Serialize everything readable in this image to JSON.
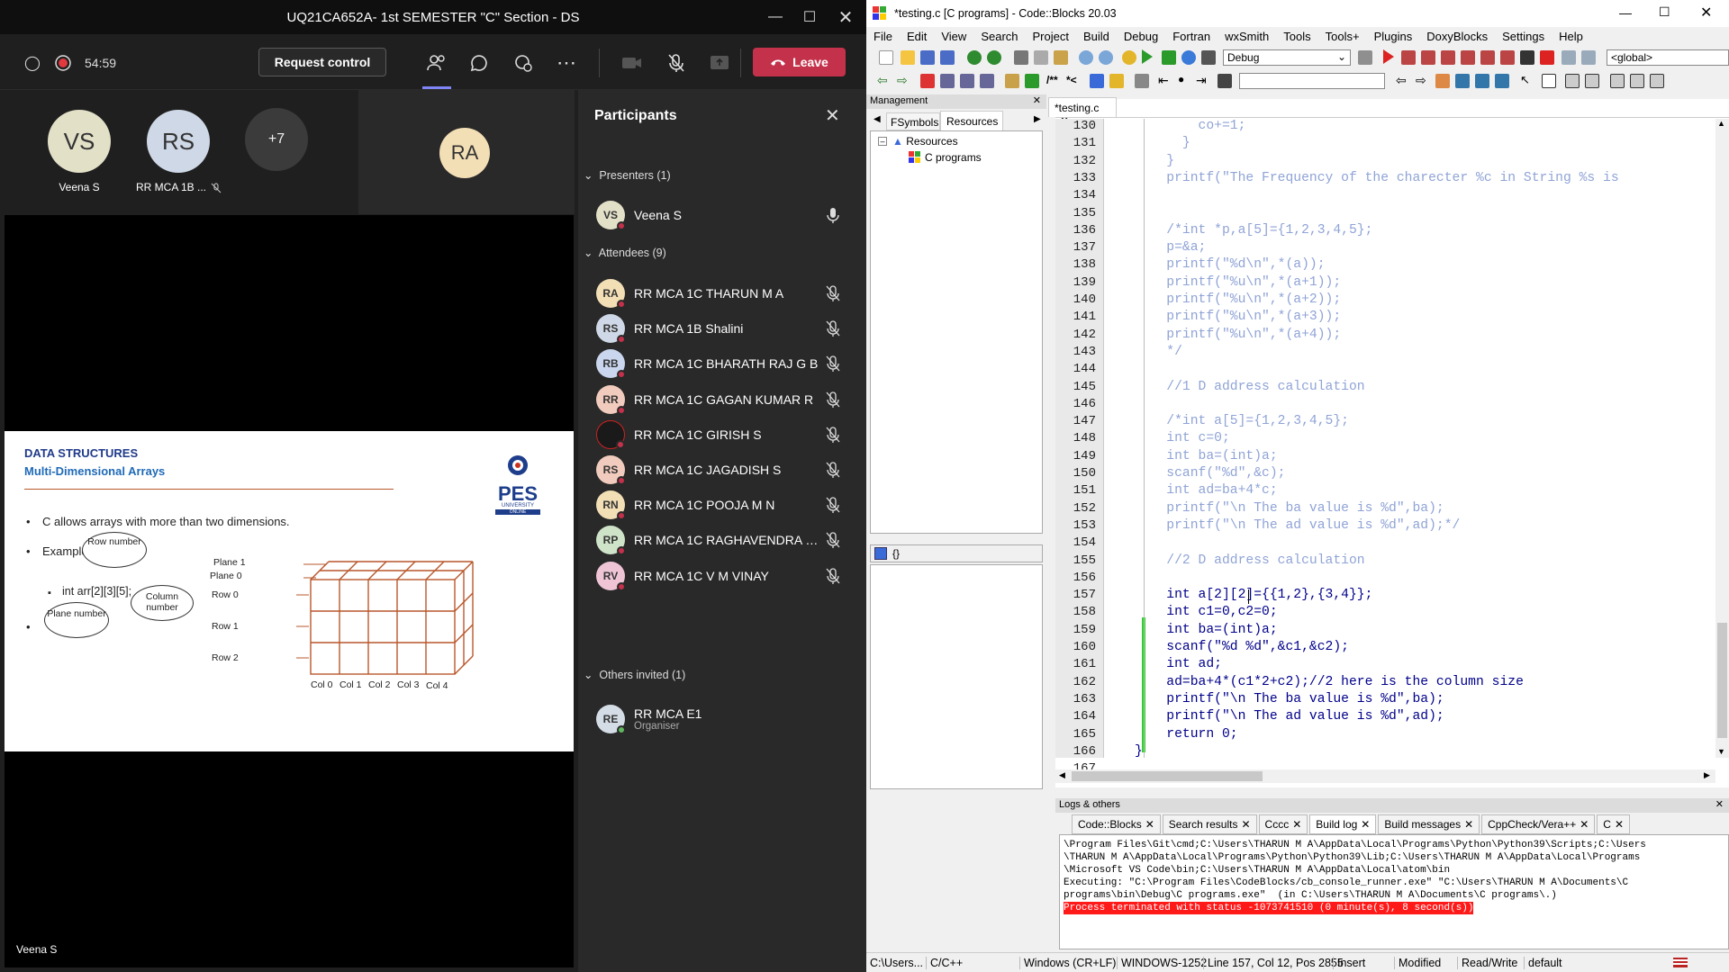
{
  "teams": {
    "title": "UQ21CA652A- 1st SEMESTER \"C\" Section - DS",
    "timer": "54:59",
    "request_control": "Request control",
    "leave": "Leave",
    "tiles": [
      {
        "initials": "VS",
        "name": "Veena S",
        "color": "#e3e0c8"
      },
      {
        "initials": "RS",
        "name": "RR MCA 1B ...",
        "color": "#cfd8e6"
      },
      {
        "initials": "+7",
        "name": "",
        "color": "#3b3b3b"
      },
      {
        "initials": "RA",
        "name": "",
        "color": "#f3dfb6"
      }
    ],
    "presenter_label": "Veena S",
    "panel": {
      "title": "Participants",
      "presenters_header": "Presenters (1)",
      "attendees_header": "Attendees (9)",
      "others_header": "Others invited (1)",
      "presenters": [
        {
          "initials": "VS",
          "name": "Veena S",
          "color": "#e3e0c8"
        }
      ],
      "attendees": [
        {
          "initials": "RA",
          "name": "RR MCA 1C THARUN M A",
          "color": "#f3dfb6"
        },
        {
          "initials": "RS",
          "name": "RR MCA 1B Shalini",
          "color": "#cfd8e6"
        },
        {
          "initials": "RB",
          "name": "RR MCA 1C BHARATH RAJ G B",
          "color": "#c9d6ee"
        },
        {
          "initials": "RR",
          "name": "RR MCA 1C GAGAN KUMAR R",
          "color": "#f1cbbd"
        },
        {
          "initials": "",
          "name": "RR MCA 1C GIRISH S",
          "color": "#1a1a1a"
        },
        {
          "initials": "RS",
          "name": "RR MCA 1C JAGADISH S",
          "color": "#f1cbbd"
        },
        {
          "initials": "RN",
          "name": "RR MCA 1C POOJA M N",
          "color": "#f3dfb6"
        },
        {
          "initials": "RP",
          "name": "RR MCA 1C RAGHAVENDRA N P...",
          "color": "#cfe3c8"
        },
        {
          "initials": "RV",
          "name": "RR MCA 1C V M VINAY",
          "color": "#efc5d6"
        }
      ],
      "others": [
        {
          "initials": "RE",
          "name": "RR MCA E1",
          "sub": "Organiser",
          "color": "#d4dde6"
        }
      ]
    },
    "slide": {
      "title1": "DATA STRUCTURES",
      "title2": "Multi-Dimensional Arrays",
      "bullet1": "C allows arrays with more than two dimensions.",
      "bullet2": "Example",
      "code": "int arr[2][3][5];",
      "bubble_row": "Row number",
      "bubble_col": "Column number",
      "bubble_plane": "Plane number",
      "plane1": "Plane 1",
      "plane0": "Plane 0",
      "rows": [
        "Row 0",
        "Row 1",
        "Row 2"
      ],
      "cols": [
        "Col 0",
        "Col 1",
        "Col 2",
        "Col 3",
        "Col 4"
      ],
      "logo": "PES",
      "logo_sub": "UNIVERSITY",
      "logo_sub2": "ONLINE"
    }
  },
  "codeblocks": {
    "title": "*testing.c [C programs] - Code::Blocks 20.03",
    "menu": [
      "File",
      "Edit",
      "View",
      "Search",
      "Project",
      "Build",
      "Debug",
      "Fortran",
      "wxSmith",
      "Tools",
      "Tools+",
      "Plugins",
      "DoxyBlocks",
      "Settings",
      "Help"
    ],
    "build_target": "Debug",
    "scope": "<global>",
    "management": {
      "title": "Management",
      "tabs": [
        "FSymbols",
        "Resources"
      ],
      "tree_root": "Resources",
      "tree_child": "C programs",
      "bottom_tab": "{}"
    },
    "editor_tab": "*testing.c",
    "lines": [
      {
        "n": "130",
        "t": "        co+=1;"
      },
      {
        "n": "131",
        "t": "      }"
      },
      {
        "n": "132",
        "t": "    }"
      },
      {
        "n": "133",
        "t": "    printf(\"The Frequency of the charecter %c in String %s is"
      },
      {
        "n": "134",
        "t": ""
      },
      {
        "n": "135",
        "t": ""
      },
      {
        "n": "136",
        "t": "    /*int *p,a[5]={1,2,3,4,5};"
      },
      {
        "n": "137",
        "t": "    p=&a;"
      },
      {
        "n": "138",
        "t": "    printf(\"%d\\n\",*(a));"
      },
      {
        "n": "139",
        "t": "    printf(\"%u\\n\",*(a+1));"
      },
      {
        "n": "140",
        "t": "    printf(\"%u\\n\",*(a+2));"
      },
      {
        "n": "141",
        "t": "    printf(\"%u\\n\",*(a+3));"
      },
      {
        "n": "142",
        "t": "    printf(\"%u\\n\",*(a+4));"
      },
      {
        "n": "143",
        "t": "    */"
      },
      {
        "n": "144",
        "t": ""
      },
      {
        "n": "145",
        "t": "    //1 D address calculation"
      },
      {
        "n": "146",
        "t": ""
      },
      {
        "n": "147",
        "t": "    /*int a[5]={1,2,3,4,5};"
      },
      {
        "n": "148",
        "t": "    int c=0;"
      },
      {
        "n": "149",
        "t": "    int ba=(int)a;"
      },
      {
        "n": "150",
        "t": "    scanf(\"%d\",&c);"
      },
      {
        "n": "151",
        "t": "    int ad=ba+4*c;"
      },
      {
        "n": "152",
        "t": "    printf(\"\\n The ba value is %d\",ba);"
      },
      {
        "n": "153",
        "t": "    printf(\"\\n The ad value is %d\",ad);*/"
      },
      {
        "n": "154",
        "t": ""
      },
      {
        "n": "155",
        "t": "    //2 D address calculation"
      },
      {
        "n": "156",
        "t": ""
      },
      {
        "n": "157",
        "t": "    int a[2][2]={{1,2},{3,4}};"
      },
      {
        "n": "158",
        "t": "    int c1=0,c2=0;"
      },
      {
        "n": "159",
        "t": "    int ba=(int)a;"
      },
      {
        "n": "160",
        "t": "    scanf(\"%d %d\",&c1,&c2);"
      },
      {
        "n": "161",
        "t": "    int ad;"
      },
      {
        "n": "162",
        "t": "    ad=ba+4*(c1*2+c2);//2 here is the column size"
      },
      {
        "n": "163",
        "t": "    printf(\"\\n The ba value is %d\",ba);"
      },
      {
        "n": "164",
        "t": "    printf(\"\\n The ad value is %d\",ad);"
      },
      {
        "n": "165",
        "t": "    return 0;"
      },
      {
        "n": "166",
        "t": "}"
      },
      {
        "n": "167",
        "t": ""
      }
    ],
    "logs": {
      "title": "Logs & others",
      "tabs": [
        "Code::Blocks",
        "Search results",
        "Cccc",
        "Build log",
        "Build messages",
        "CppCheck/Vera++",
        "C"
      ],
      "lines": [
        "\\Program Files\\Git\\cmd;C:\\Users\\THARUN M A\\AppData\\Local\\Programs\\Python\\Python39\\Scripts;C:\\Users",
        "\\THARUN M A\\AppData\\Local\\Programs\\Python\\Python39\\Lib;C:\\Users\\THARUN M A\\AppData\\Local\\Programs",
        "\\Microsoft VS Code\\bin;C:\\Users\\THARUN M A\\AppData\\Local\\atom\\bin",
        "Executing: \"C:\\Program Files\\CodeBlocks/cb_console_runner.exe\" \"C:\\Users\\THARUN M A\\Documents\\C",
        "programs\\bin\\Debug\\C programs.exe\"  (in C:\\Users\\THARUN M A\\Documents\\C programs\\.)"
      ],
      "error": "Process terminated with status -1073741510 (0 minute(s), 8 second(s))"
    },
    "status": {
      "path": "C:\\Users...",
      "lang": "C/C++",
      "eol": "Windows (CR+LF)",
      "enc": "WINDOWS-1252",
      "pos": "Line 157, Col 12, Pos 2855",
      "mode": "Insert",
      "mod": "Modified",
      "rw": "Read/Write",
      "def": "default"
    }
  }
}
